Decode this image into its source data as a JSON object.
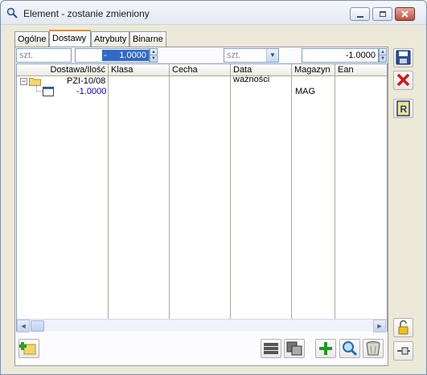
{
  "window": {
    "title": "Element - zostanie zmieniony"
  },
  "tabs": [
    {
      "label": "Ogólne"
    },
    {
      "label": "Dostawy"
    },
    {
      "label": "Atrybuty"
    },
    {
      "label": "Binarne"
    }
  ],
  "filters": {
    "unit_left_placeholder": "szt.",
    "qty_left_prefix": "-",
    "qty_left_value": "1.0000",
    "unit_right_value": "szt.",
    "qty_right_value": "-1.0000"
  },
  "grid": {
    "columns": [
      "Dostawa/Ilość",
      "Klasa",
      "Cecha",
      "Data ważności",
      "Magazyn",
      "Ean"
    ],
    "rows": [
      {
        "tree_toggle": "−",
        "delivery": "PZI-10/08"
      },
      {
        "qty": "-1.0000",
        "warehouse": "MAG"
      }
    ]
  }
}
